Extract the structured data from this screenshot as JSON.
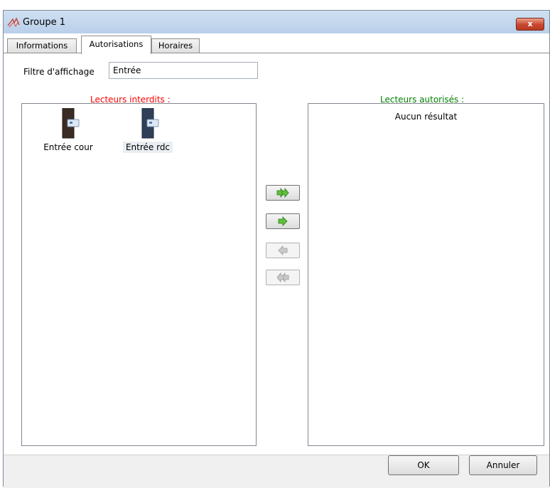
{
  "window": {
    "title": "Groupe 1",
    "close_label": "x"
  },
  "tabs": [
    {
      "label": "Informations",
      "active": false
    },
    {
      "label": "Autorisations",
      "active": true
    },
    {
      "label": "Horaires",
      "active": false
    }
  ],
  "filter": {
    "label": "Filtre d'affichage",
    "value": "Entrée"
  },
  "forbidden": {
    "title": "Lecteurs interdits :",
    "title_color": "#ff0000",
    "items": [
      {
        "label": "Entrée cour",
        "icon": "reader-door-dark-icon",
        "selected": false
      },
      {
        "label": "Entrée rdc",
        "icon": "reader-door-blue-icon",
        "selected": true
      }
    ]
  },
  "allowed": {
    "title": "Lecteurs autorisés :",
    "title_color": "#008000",
    "empty_text": "Aucun résultat"
  },
  "transfer_buttons": [
    {
      "icon": "double-arrow-right-icon",
      "enabled": true
    },
    {
      "icon": "arrow-right-icon",
      "enabled": true
    },
    {
      "icon": "arrow-left-icon",
      "enabled": false
    },
    {
      "icon": "double-arrow-left-icon",
      "enabled": false
    }
  ],
  "dialog": {
    "ok_label": "OK",
    "cancel_label": "Annuler"
  }
}
